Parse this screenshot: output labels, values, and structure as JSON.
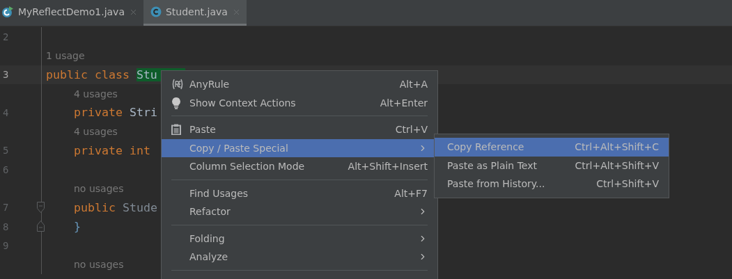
{
  "tabs": [
    {
      "label": "MyReflectDemo1.java",
      "kind": "runnable",
      "selected": false
    },
    {
      "label": "Student.java",
      "kind": "class",
      "selected": true
    }
  ],
  "editor": {
    "lines": [
      {
        "kind": "code",
        "number": "2",
        "current": false
      },
      {
        "kind": "hint",
        "text": "1 usage",
        "indent": false
      },
      {
        "kind": "code",
        "number": "3",
        "current": true,
        "indent": false,
        "tokens": [
          {
            "kind": "keyword",
            "text": "public class "
          },
          {
            "kind": "match",
            "text": "Stu"
          }
        ]
      },
      {
        "kind": "hint",
        "text": "4 usages",
        "indent": true
      },
      {
        "kind": "code",
        "number": "4",
        "current": false,
        "indent": true,
        "tokens": [
          {
            "kind": "keyword",
            "text": "private "
          },
          {
            "kind": "plain",
            "text": "Stri"
          }
        ]
      },
      {
        "kind": "hint",
        "text": "4 usages",
        "indent": true
      },
      {
        "kind": "code",
        "number": "5",
        "current": false,
        "indent": true,
        "tokens": [
          {
            "kind": "keyword",
            "text": "private int"
          }
        ]
      },
      {
        "kind": "code",
        "number": "6",
        "current": false
      },
      {
        "kind": "hint",
        "text": "no usages",
        "indent": true
      },
      {
        "kind": "fold_start",
        "number": "7",
        "current": false,
        "indent": true,
        "tokens": [
          {
            "kind": "keyword",
            "text": "public "
          },
          {
            "kind": "dim",
            "text": "Stude"
          }
        ]
      },
      {
        "kind": "fold_end",
        "number": "8",
        "current": false,
        "indent": true,
        "tokens": [
          {
            "kind": "brace",
            "text": "}"
          }
        ]
      },
      {
        "kind": "code",
        "number": "9",
        "current": false
      },
      {
        "kind": "hint",
        "text": "no usages",
        "indent": true
      }
    ]
  },
  "context_menu": {
    "items": [
      {
        "kind": "regex",
        "label": "AnyRule",
        "shortcut": "Alt+A",
        "selected": false
      },
      {
        "kind": "bulb",
        "label": "Show Context Actions",
        "shortcut": "Alt+Enter",
        "selected": false
      },
      {
        "kind": "separator"
      },
      {
        "kind": "clipboard",
        "label": "Paste",
        "shortcut": "Ctrl+V",
        "selected": false
      },
      {
        "kind": "submenu",
        "label": "Copy / Paste Special",
        "selected": true
      },
      {
        "kind": "item",
        "label": "Column Selection Mode",
        "shortcut": "Alt+Shift+Insert",
        "selected": false
      },
      {
        "kind": "separator"
      },
      {
        "kind": "item",
        "label": "Find Usages",
        "shortcut": "Alt+F7",
        "selected": false
      },
      {
        "kind": "submenu",
        "label": "Refactor",
        "selected": false
      },
      {
        "kind": "separator"
      },
      {
        "kind": "submenu",
        "label": "Folding",
        "selected": false
      },
      {
        "kind": "submenu",
        "label": "Analyze",
        "selected": false
      },
      {
        "kind": "separator"
      }
    ]
  },
  "submenu": {
    "items": [
      {
        "label": "Copy Reference",
        "shortcut": "Ctrl+Alt+Shift+C",
        "selected": true
      },
      {
        "label": "Paste as Plain Text",
        "shortcut": "Ctrl+Alt+Shift+V",
        "selected": false
      },
      {
        "label": "Paste from History...",
        "shortcut": "Ctrl+Shift+V",
        "selected": false
      }
    ]
  }
}
